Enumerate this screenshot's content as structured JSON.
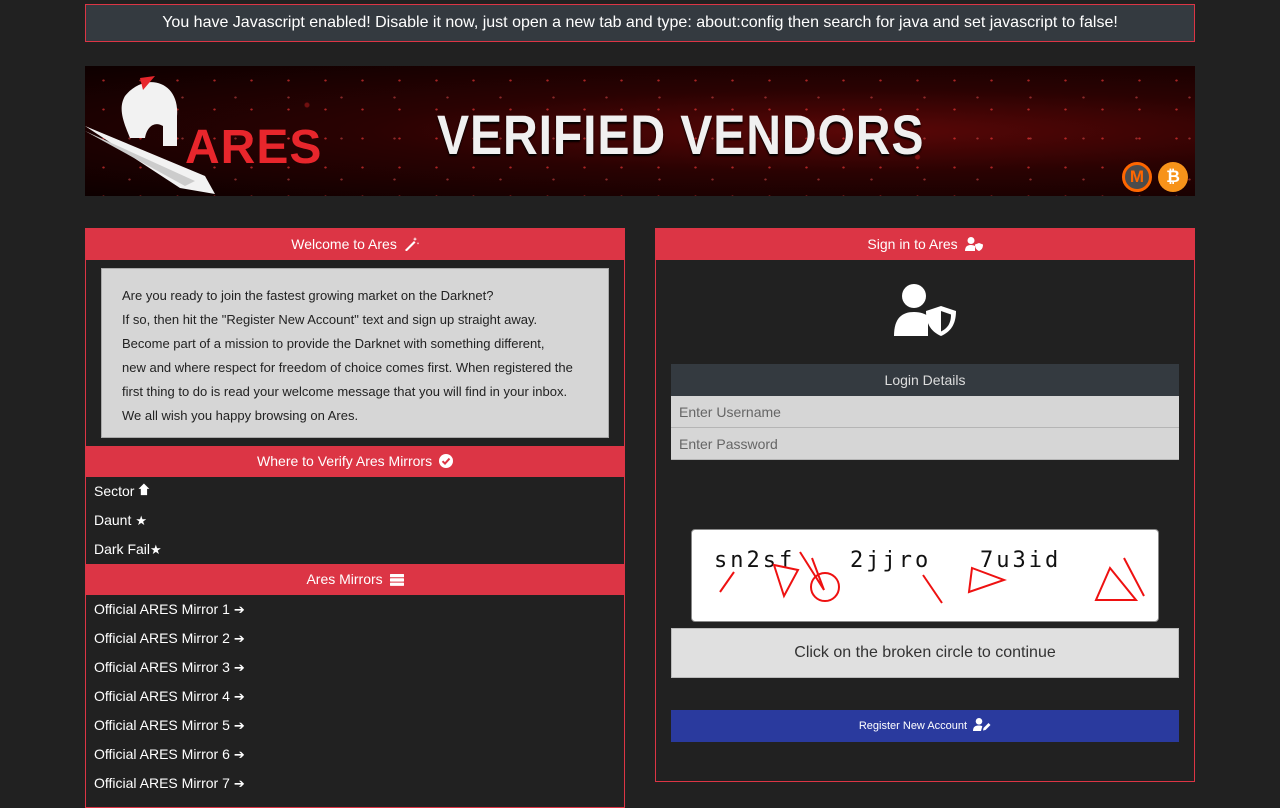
{
  "alert": {
    "text": "You have Javascript enabled! Disable it now, just open a new tab and type: about:config then search for java and set javascript to false!"
  },
  "banner": {
    "logo_text": "ARES",
    "headline": "VERIFIED VENDORS",
    "coins": [
      "monero-icon",
      "bitcoin-icon"
    ]
  },
  "welcome": {
    "title": "Welcome to Ares",
    "title_icon": "magic-wand-icon",
    "lines": [
      "Are you ready to join the fastest growing market on the Darknet?",
      "If so, then hit the \"Register New Account\" text and sign up straight away.",
      "Become part of a mission to provide the Darknet with something different,",
      "new and where respect for freedom of choice comes first. When registered the",
      "first thing to do is read your welcome message that you will find in your inbox.",
      "We all wish you happy browsing on Ares."
    ]
  },
  "verify": {
    "title": "Where to Verify Ares Mirrors",
    "title_icon": "check-circle-icon",
    "items": [
      {
        "label": "Sector",
        "icon": "arrow-up-icon"
      },
      {
        "label": "Daunt",
        "icon": "star-icon"
      },
      {
        "label": "Dark Fail",
        "icon": "star-icon"
      }
    ]
  },
  "mirrors": {
    "title": "Ares Mirrors",
    "title_icon": "server-icon",
    "items": [
      "Official ARES Mirror 1",
      "Official ARES Mirror 2",
      "Official ARES Mirror 3",
      "Official ARES Mirror 4",
      "Official ARES Mirror 5",
      "Official ARES Mirror 6",
      "Official ARES Mirror 7"
    ]
  },
  "signin": {
    "title": "Sign in to Ares",
    "title_icon": "user-shield-icon",
    "login_title": "Login Details",
    "username_placeholder": "Enter Username",
    "password_placeholder": "Enter Password",
    "captcha": [
      "sn2sf",
      "2jjro",
      "7u3id"
    ],
    "captcha_hint": "Click on the broken circle to continue",
    "register_label": "Register New Account"
  },
  "colors": {
    "accent": "#dc3545",
    "background": "#212121",
    "register": "#2a3a9e"
  }
}
